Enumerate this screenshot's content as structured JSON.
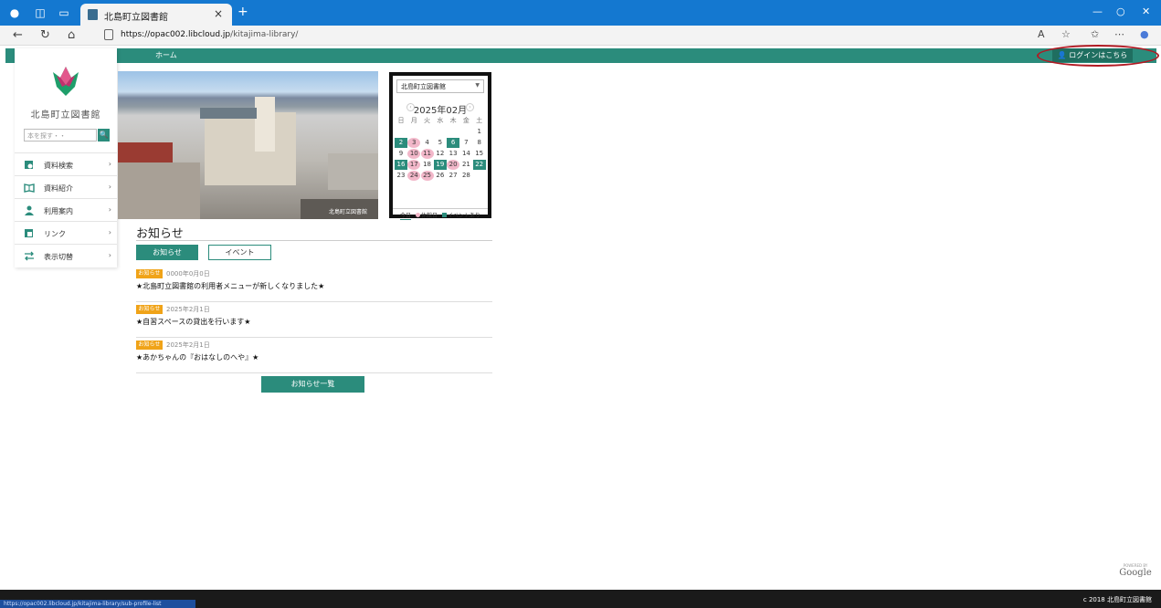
{
  "browser": {
    "tab_title": "北島町立図書館",
    "tab_close": "×",
    "new_tab": "+",
    "url_domain": "https://opac002.libcloud.jp",
    "url_path": "/kitajima-library/",
    "status_url": "https://opac002.libcloud.jp/kitajima-library/sub-profile-list"
  },
  "site": {
    "home_label": "ホーム",
    "login_label": "ログインはこちら",
    "library_name": "北島町立図書館",
    "search_placeholder": "本を探す・・",
    "photo_caption": "北島町立図書館",
    "brand_colors": {
      "accent": "#2b8c7c",
      "badge": "#f0a318",
      "holiday": "#f2b7c9",
      "highlight_ring": "#b11a23"
    }
  },
  "menu": [
    {
      "label": "資料検索",
      "icon": "book-search-icon"
    },
    {
      "label": "資料紹介",
      "icon": "open-book-icon"
    },
    {
      "label": "利用案内",
      "icon": "person-icon"
    },
    {
      "label": "リンク",
      "icon": "link-icon"
    },
    {
      "label": "表示切替",
      "icon": "switch-icon"
    }
  ],
  "calendar": {
    "select_value": "北島町立図書館",
    "month_label": "2025年02月",
    "weekdays": [
      "日",
      "月",
      "火",
      "水",
      "木",
      "金",
      "土"
    ],
    "rows": [
      [
        "",
        "",
        "",
        "",
        "",
        "",
        "1"
      ],
      [
        "2",
        "3",
        "4",
        "5",
        "6",
        "7",
        "8"
      ],
      [
        "9",
        "10",
        "11",
        "12",
        "13",
        "14",
        "15"
      ],
      [
        "16",
        "17",
        "18",
        "19",
        "20",
        "21",
        "22"
      ],
      [
        "23",
        "24",
        "25",
        "26",
        "27",
        "28",
        ""
      ]
    ],
    "event_days": [
      "2",
      "6",
      "16",
      "19",
      "22"
    ],
    "holiday_days": [
      "3",
      "10",
      "11",
      "17",
      "20",
      "24",
      "25"
    ],
    "legend_today": "今日",
    "legend_holiday": "休館日",
    "legend_event": "イベントあり"
  },
  "news": {
    "heading": "お知らせ",
    "tab_news": "お知らせ",
    "tab_event": "イベント",
    "items": [
      {
        "badge": "お知らせ",
        "date": "0000年0月0日",
        "title": "★北島町立図書館の利用者メニューが新しくなりました★"
      },
      {
        "badge": "お知らせ",
        "date": "2025年2月1日",
        "title": "★自習スペースの貸出を行います★"
      },
      {
        "badge": "お知らせ",
        "date": "2025年2月1日",
        "title": "★あかちゃんの『おはなしのへや』★"
      }
    ],
    "all_button": "お知らせ一覧"
  },
  "footer": {
    "powered_by": "POWERED BY",
    "google": "Google",
    "copyright": "c 2018 北島町立図書館"
  }
}
